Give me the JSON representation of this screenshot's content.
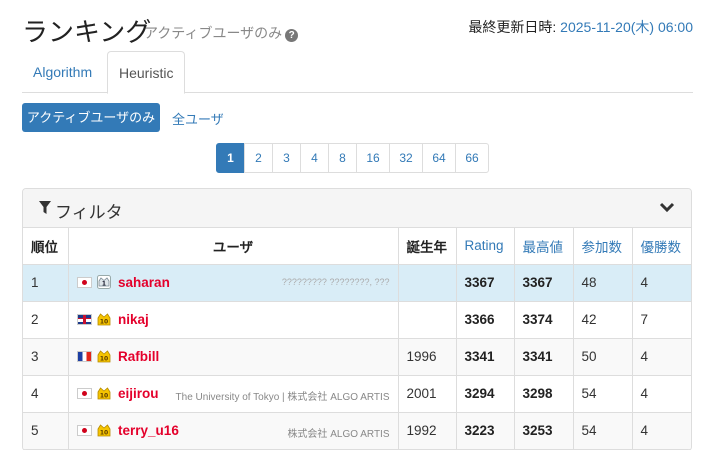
{
  "header": {
    "title": "ランキング",
    "subtitle": "アクティブユーザのみ",
    "help_icon": "question-circle-icon",
    "updated_label": "最終更新日時: ",
    "updated_value": "2025-11-20(木) 06:00"
  },
  "tabs": [
    {
      "label": "Algorithm",
      "active": false
    },
    {
      "label": "Heuristic",
      "active": true
    }
  ],
  "filters": {
    "active_only_label": "アクティブユーザのみ",
    "all_users_label": "全ユーザ"
  },
  "pagination": {
    "pages": [
      "1",
      "2",
      "3",
      "4",
      "8",
      "16",
      "32",
      "64",
      "66"
    ],
    "current": "1"
  },
  "panel": {
    "filter_label": "フィルタ",
    "filter_icon": "filter-icon",
    "toggle_icon": "chevron-down-icon"
  },
  "table": {
    "headers": {
      "rank": "順位",
      "user": "ユーザ",
      "birth_year": "誕生年",
      "rating": "Rating",
      "highest": "最高値",
      "entries": "参加数",
      "wins": "優勝数"
    },
    "rows": [
      {
        "rank": "1",
        "flag": "jp",
        "crown": "crown-1-icon",
        "user": "saharan",
        "affiliation": "????????? ????????, ???",
        "birth_year": "",
        "rating": "3367",
        "highest": "3367",
        "entries": "48",
        "wins": "4"
      },
      {
        "rank": "2",
        "flag": "uk",
        "crown": "crown-10-icon",
        "user": "nikaj",
        "affiliation": "",
        "birth_year": "",
        "rating": "3366",
        "highest": "3374",
        "entries": "42",
        "wins": "7"
      },
      {
        "rank": "3",
        "flag": "fr",
        "crown": "crown-10-icon",
        "user": "Rafbill",
        "affiliation": "",
        "birth_year": "1996",
        "rating": "3341",
        "highest": "3341",
        "entries": "50",
        "wins": "4"
      },
      {
        "rank": "4",
        "flag": "jp",
        "crown": "crown-10-icon",
        "user": "eijirou",
        "affiliation": "The University of Tokyo | 株式会社 ALGO ARTIS",
        "birth_year": "2001",
        "rating": "3294",
        "highest": "3298",
        "entries": "54",
        "wins": "4"
      },
      {
        "rank": "5",
        "flag": "jp",
        "crown": "crown-10-icon",
        "user": "terry_u16",
        "affiliation": "株式会社 ALGO ARTIS",
        "birth_year": "1992",
        "rating": "3223",
        "highest": "3253",
        "entries": "54",
        "wins": "4"
      }
    ]
  },
  "colors": {
    "link": "#337ab7",
    "username_red": "#e4002b",
    "highlight_row": "#d9edf7"
  }
}
